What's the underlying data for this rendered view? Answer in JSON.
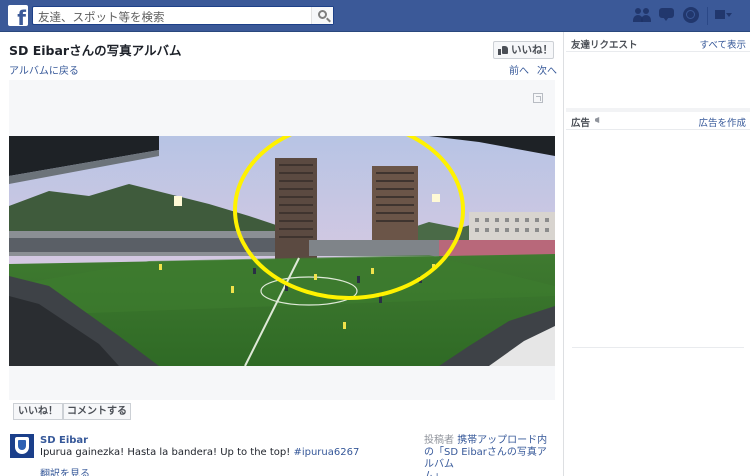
{
  "topbar": {
    "logo": "f",
    "search_placeholder": "友達、スポット等を検索",
    "icons": [
      "friends-icon",
      "messages-icon",
      "notifications-globe-icon",
      "menu-icon"
    ],
    "brand_color": "#3b5998"
  },
  "album": {
    "title": "SD Eibarさんの写真アルバム",
    "like_page_label": "いいね！",
    "back_link": "アルバムに戻る",
    "prev": "前へ",
    "next": "次へ"
  },
  "photo": {
    "description_icon": "expand-icon",
    "highlight_color": "#fff200"
  },
  "actions": {
    "like": "いいね！",
    "comment": "コメントする"
  },
  "post": {
    "author": "SD Eibar",
    "text": "Ipurua gainezka! Hasta la bandera! Up to the top! ",
    "hashtag": "#ipurua6267",
    "translate": "翻訳を見る",
    "posted_by_label": "投稿者 ",
    "album_link": "携帯アップロード内の「SD Eibarさんの写真アルバム",
    "album_link_end": "ム」"
  },
  "sidebar": {
    "friend_requests_title": "友達リクエスト",
    "friend_requests_link": "すべて表示",
    "ads_title": "広告",
    "ads_link": "広告を作成"
  }
}
